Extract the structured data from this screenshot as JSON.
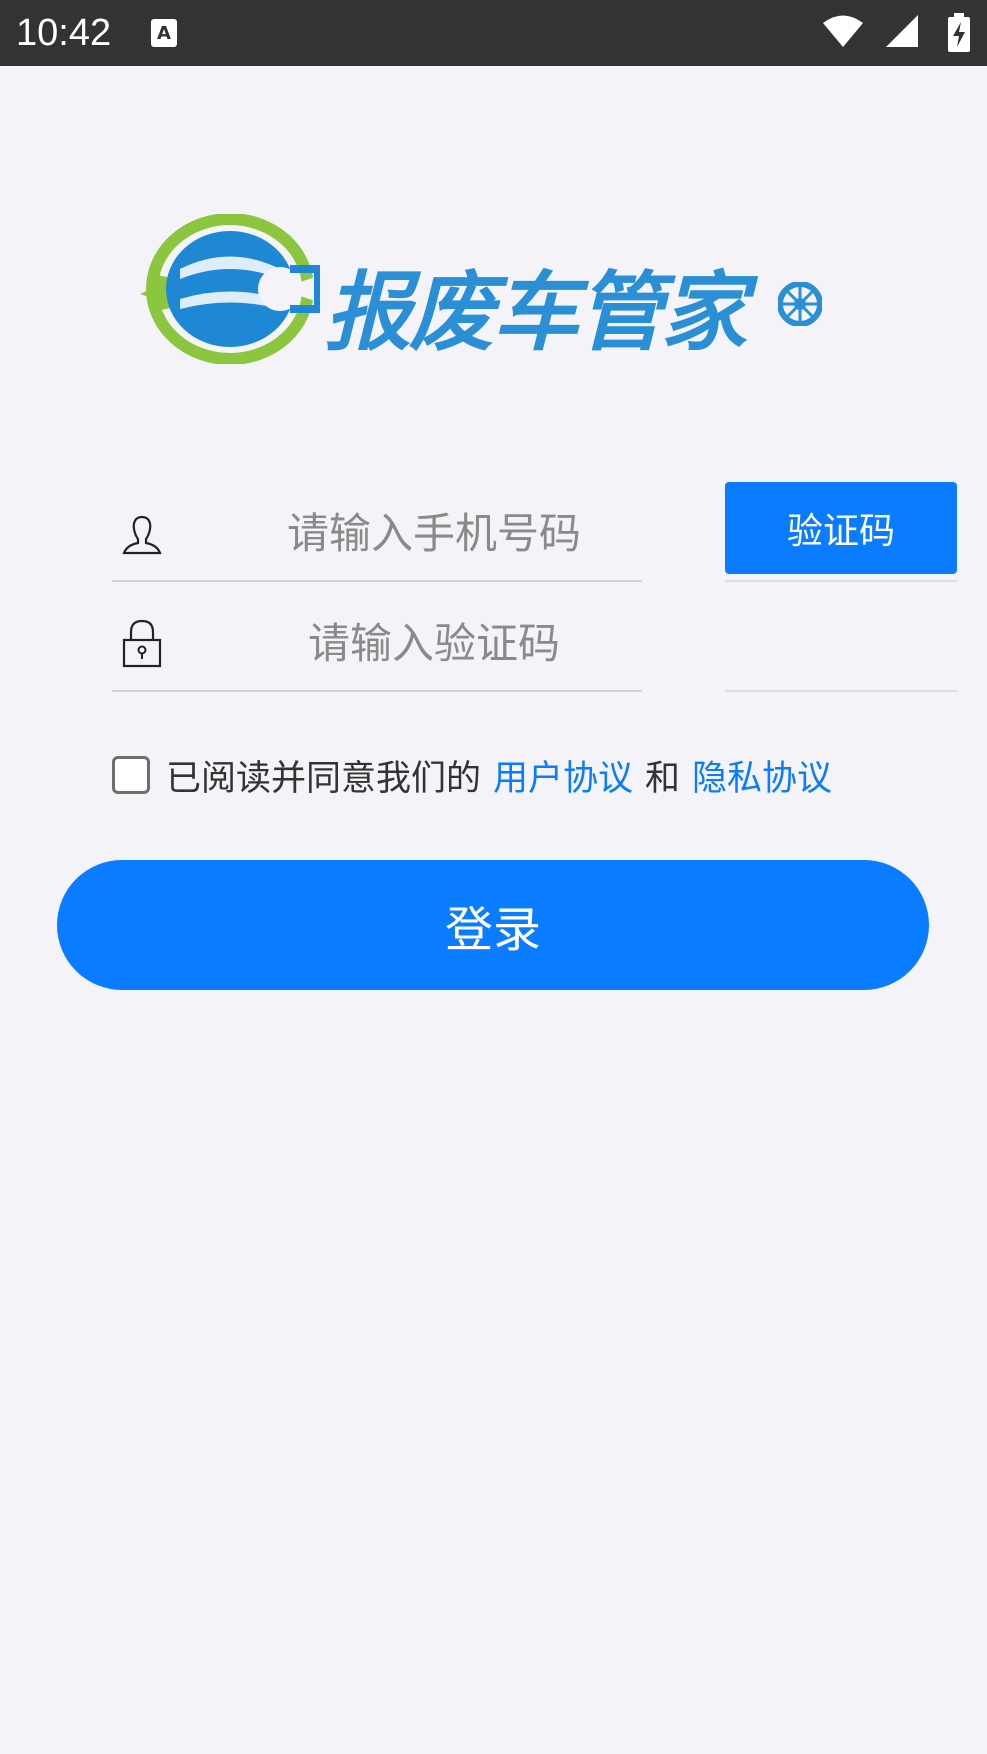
{
  "status_bar": {
    "time": "10:42",
    "icons": [
      "notification-a-icon",
      "wifi-icon",
      "signal-icon",
      "battery-charging-icon"
    ]
  },
  "logo": {
    "text": "报废车管家",
    "colors": {
      "blue": "#2a8fd4",
      "green": "#8cc63f"
    }
  },
  "form": {
    "phone_placeholder": "请输入手机号码",
    "code_placeholder": "请输入验证码",
    "get_code_label": "验证码"
  },
  "agreement": {
    "prefix": "已阅读并同意我们的",
    "user_agreement": "用户协议",
    "conjunction": "和",
    "privacy_agreement": "隐私协议",
    "checked": false
  },
  "login_button": {
    "label": "登录"
  },
  "colors": {
    "accent": "#0a7cff",
    "background": "#f4f4f8",
    "status_bar": "#333333"
  }
}
